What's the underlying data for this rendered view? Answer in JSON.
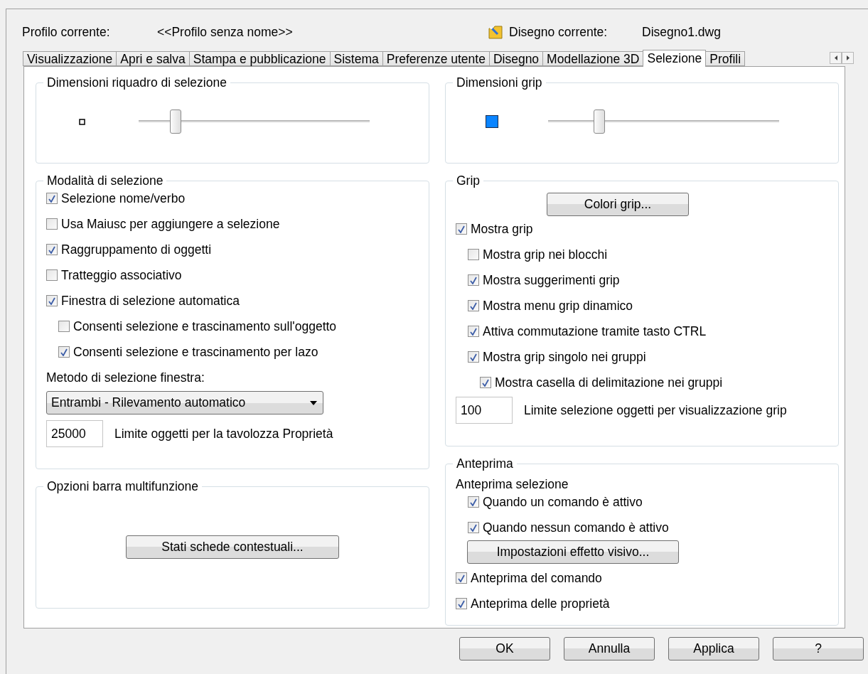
{
  "header": {
    "profile_label": "Profilo corrente:",
    "profile_value": "<<Profilo senza nome>>",
    "drawing_label": "Disegno corrente:",
    "drawing_value": "Disegno1.dwg"
  },
  "tabs": [
    {
      "label": "Visualizzazione",
      "selected": false
    },
    {
      "label": "Apri e salva",
      "selected": false
    },
    {
      "label": "Stampa e pubblicazione",
      "selected": false
    },
    {
      "label": "Sistema",
      "selected": false
    },
    {
      "label": "Preferenze utente",
      "selected": false
    },
    {
      "label": "Disegno",
      "selected": false
    },
    {
      "label": "Modellazione 3D",
      "selected": false
    },
    {
      "label": "Selezione",
      "selected": true
    },
    {
      "label": "Profili",
      "selected": false
    }
  ],
  "pickbox_size": {
    "title": "Dimensioni riquadro di selezione",
    "level": 0.16
  },
  "selection_modes": {
    "title": "Modalità di selezione",
    "options": [
      {
        "label": "Selezione nome/verbo",
        "checked": true
      },
      {
        "label": "Usa Maiusc per aggiungere a selezione",
        "checked": false
      },
      {
        "label": "Raggruppamento di oggetti",
        "checked": true
      },
      {
        "label": "Tratteggio associativo",
        "checked": false
      },
      {
        "label": "Finestra di selezione automatica",
        "checked": true,
        "children": [
          {
            "label": "Consenti selezione e trascinamento sull'oggetto",
            "checked": false
          },
          {
            "label": "Consenti selezione e trascinamento per lazo",
            "checked": true
          }
        ]
      }
    ],
    "window_method_label": "Metodo di selezione finestra:",
    "window_method_value": "Entrambi - Rilevamento automatico",
    "limit_value": "25000",
    "limit_label": "Limite oggetti per la tavolozza Proprietà"
  },
  "ribbon_options": {
    "title": "Opzioni barra multifunzione",
    "button": "Stati schede contestuali..."
  },
  "grip_size": {
    "title": "Dimensioni grip",
    "level": 0.22
  },
  "grips": {
    "title": "Grip",
    "button": "Colori grip...",
    "options": [
      {
        "label": "Mostra grip",
        "checked": true,
        "children": [
          {
            "label": "Mostra grip nei blocchi",
            "checked": false
          },
          {
            "label": "Mostra suggerimenti grip",
            "checked": true
          },
          {
            "label": "Mostra menu grip dinamico",
            "checked": true
          },
          {
            "label": "Attiva commutazione tramite tasto CTRL",
            "checked": true
          },
          {
            "label": "Mostra grip singolo nei gruppi",
            "checked": true,
            "children": [
              {
                "label": "Mostra casella di delimitazione nei gruppi",
                "checked": true
              }
            ]
          }
        ]
      }
    ],
    "limit_value": "100",
    "limit_label": "Limite selezione oggetti per visualizzazione grip"
  },
  "preview": {
    "title": "Anteprima",
    "subtitle": "Anteprima selezione",
    "selection_options": [
      {
        "label": "Quando un comando è attivo",
        "checked": true
      },
      {
        "label": "Quando nessun comando è attivo",
        "checked": true
      }
    ],
    "button": "Impostazioni effetto visivo...",
    "options": [
      {
        "label": "Anteprima del comando",
        "checked": true
      },
      {
        "label": "Anteprima delle proprietà",
        "checked": true
      }
    ]
  },
  "buttons": [
    "OK",
    "Annulla",
    "Applica",
    "?"
  ]
}
